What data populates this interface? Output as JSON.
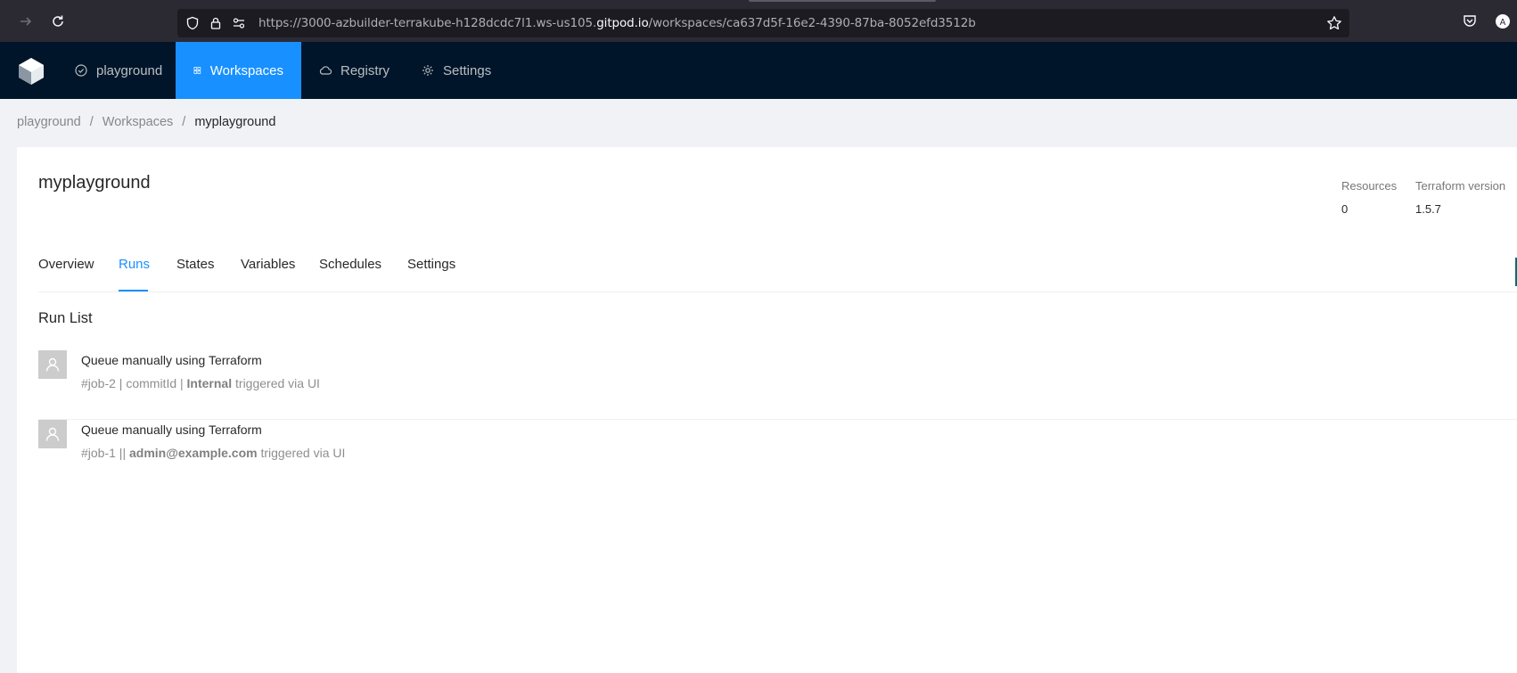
{
  "browser": {
    "url_prefix": "https://3000-azbuilder-terrakube-h128dcdc7l1.ws-us105.",
    "url_domain": "gitpod.io",
    "url_path": "/workspaces/ca637d5f-16e2-4390-87ba-8052efd3512b"
  },
  "header": {
    "menu": [
      {
        "label": "playground",
        "icon": "check-circle-icon"
      },
      {
        "label": "Workspaces",
        "icon": "grid-icon"
      },
      {
        "label": "Registry",
        "icon": "cloud-icon"
      },
      {
        "label": "Settings",
        "icon": "gear-icon"
      }
    ],
    "accent": "#1890ff",
    "background": "#001529"
  },
  "breadcrumb": {
    "items": [
      "playground",
      "Workspaces",
      "myplayground"
    ],
    "separator": "/"
  },
  "workspace": {
    "title": "myplayground",
    "stats": [
      {
        "label": "Resources",
        "value": "0"
      },
      {
        "label": "Terraform version",
        "value": "1.5.7"
      }
    ]
  },
  "tabs": [
    "Overview",
    "Runs",
    "States",
    "Variables",
    "Schedules",
    "Settings"
  ],
  "active_tab": "Runs",
  "runs": {
    "title": "Run List",
    "items": [
      {
        "title": "Queue manually using Terraform",
        "job": "#job-2",
        "mid": " | commitId | ",
        "source": "Internal",
        "trigger": " triggered via UI"
      },
      {
        "title": "Queue manually using Terraform",
        "job": "#job-1",
        "mid": " || ",
        "source": "admin@example.com",
        "trigger": " triggered via UI"
      }
    ]
  }
}
